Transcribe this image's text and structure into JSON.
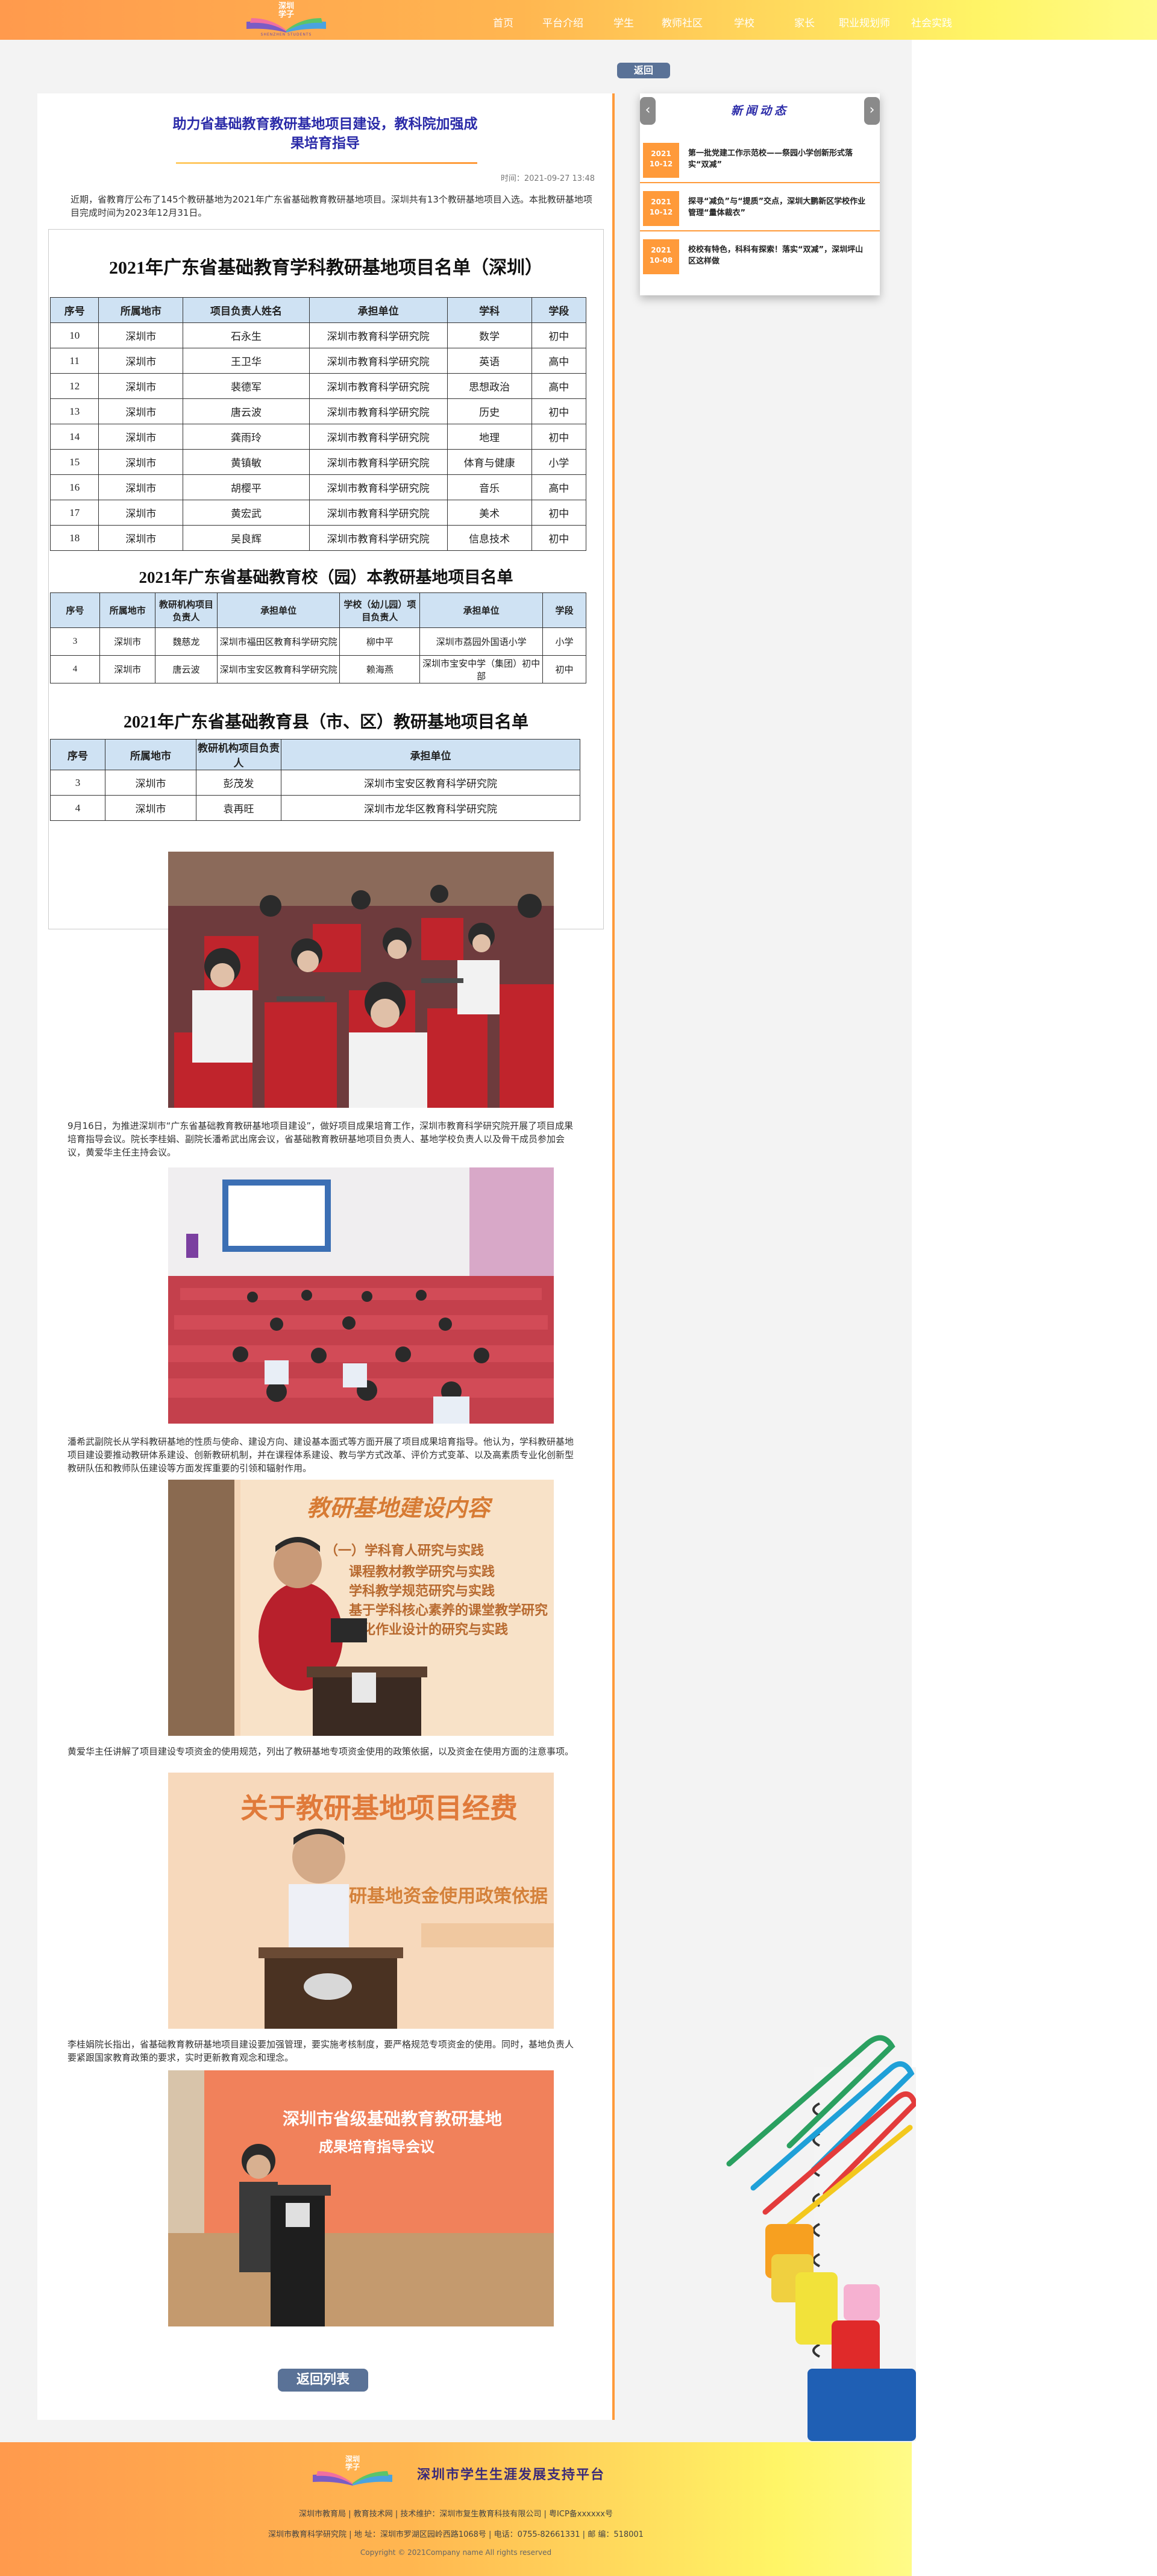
{
  "header": {
    "logo_text": "深圳\n学子",
    "logo_sub": "SHENZHEN STUDENTS",
    "nav": [
      "首页",
      "平台介绍",
      "学生",
      "教师社区",
      "学校",
      "家长",
      "职业规划师",
      "社会实践"
    ]
  },
  "back_button": "返回",
  "article": {
    "title_line1": "助力省基础教育教研基地项目建设，教科院加强成",
    "title_line2": "果培育指导",
    "datetime": "时间：2021-09-27 13:48",
    "intro": "近期，省教育厅公布了145个教研基地为2021年广东省基础教育教研基地项目。深圳共有13个教研基地项目入选。本批教研基地项目完成时间为2023年12月31日。",
    "table1": {
      "title": "2021年广东省基础教育学科教研基地项目名单（深圳）",
      "headers": [
        "序号",
        "所属地市",
        "项目负责人姓名",
        "承担单位",
        "学科",
        "学段"
      ],
      "rows": [
        [
          "10",
          "深圳市",
          "石永生",
          "深圳市教育科学研究院",
          "数学",
          "初中"
        ],
        [
          "11",
          "深圳市",
          "王卫华",
          "深圳市教育科学研究院",
          "英语",
          "高中"
        ],
        [
          "12",
          "深圳市",
          "裴德军",
          "深圳市教育科学研究院",
          "思想政治",
          "高中"
        ],
        [
          "13",
          "深圳市",
          "唐云波",
          "深圳市教育科学研究院",
          "历史",
          "初中"
        ],
        [
          "14",
          "深圳市",
          "龚雨玲",
          "深圳市教育科学研究院",
          "地理",
          "初中"
        ],
        [
          "15",
          "深圳市",
          "黄镇敏",
          "深圳市教育科学研究院",
          "体育与健康",
          "小学"
        ],
        [
          "16",
          "深圳市",
          "胡樱平",
          "深圳市教育科学研究院",
          "音乐",
          "高中"
        ],
        [
          "17",
          "深圳市",
          "黄宏武",
          "深圳市教育科学研究院",
          "美术",
          "初中"
        ],
        [
          "18",
          "深圳市",
          "吴良辉",
          "深圳市教育科学研究院",
          "信息技术",
          "初中"
        ]
      ]
    },
    "table2": {
      "title": "2021年广东省基础教育校（园）本教研基地项目名单",
      "headers": [
        "序号",
        "所属地市",
        "教研机构项目负责人",
        "承担单位",
        "学校（幼儿园）项目负责人",
        "承担单位",
        "学段"
      ],
      "rows": [
        [
          "3",
          "深圳市",
          "魏慈龙",
          "深圳市福田区教育科学研究院",
          "柳中平",
          "深圳市荔园外国语小学",
          "小学"
        ],
        [
          "4",
          "深圳市",
          "唐云波",
          "深圳市宝安区教育科学研究院",
          "赖海燕",
          "深圳市宝安中学（集团）初中部",
          "初中"
        ]
      ]
    },
    "table3": {
      "title": "2021年广东省基础教育县（市、区）教研基地项目名单",
      "headers": [
        "序号",
        "所属地市",
        "教研机构项目负责人",
        "承担单位"
      ],
      "rows": [
        [
          "3",
          "深圳市",
          "彭茂发",
          "深圳市宝安区教育科学研究院"
        ],
        [
          "4",
          "深圳市",
          "袁再旺",
          "深圳市龙华区教育科学研究院"
        ]
      ]
    },
    "para1": "9月16日，为推进深圳市“广东省基础教育教研基地项目建设”，做好项目成果培育工作，深圳市教育科学研究院开展了项目成果培育指导会议。院长李桂娟、副院长潘希武出席会议，省基础教育教研基地项目负责人、基地学校负责人以及骨干成员参加会议，黄爱华主任主持会议。",
    "para2": "潘希武副院长从学科教研基地的性质与使命、建设方向、建设基本面式等方面开展了项目成果培育指导。他认为，学科教研基地项目建设要推动教研体系建设、创新教研机制，并在课程体系建设、教与学方式改革、评价方式变革、以及高素质专业化创新型教研队伍和教师队伍建设等方面发挥重要的引领和辐射作用。",
    "para3": "黄爱华主任讲解了项目建设专项资金的使用规范，列出了教研基地专项资金使用的政策依据，以及资金在使用方面的注意事项。",
    "para4": "李桂娟院长指出，省基础教育教研基地项目建设要加强管理，要实施考核制度，要严格规范专项资金的使用。同时，基地负责人要紧跟国家教育政策的要求，实时更新教育观念和理念。",
    "photo3_text": {
      "title": "教研基地建设内容",
      "lines": [
        "（一）学科育人研究与实践",
        "课程教材教学研究与实践",
        "学科教学规范研究与实践",
        "基于学科核心素养的课堂教学研究",
        "大化作业设计的研究与实践"
      ]
    },
    "photo4_text": {
      "title": "关于教研基地项目经费",
      "sub": "教研基地资金使用政策依据"
    },
    "photo5_text": {
      "line1": "深圳市省级基础教育教研基地",
      "line2": "成果培育指导会议"
    },
    "back_list": "返回列表"
  },
  "news": {
    "title": "新闻动态",
    "prev": "‹",
    "next": "›",
    "items": [
      {
        "date1": "2021",
        "date2": "10-12",
        "text": "第一批党建工作示范校——祭园小学创新形式落实“双减”"
      },
      {
        "date1": "2021",
        "date2": "10-12",
        "text": "探寻“减负”与“提质”交点，深圳大鹏新区学校作业管理“量体裁衣”"
      },
      {
        "date1": "2021",
        "date2": "10-08",
        "text": "校校有特色，科科有探索！落实“双减”，深圳坪山区这样做"
      }
    ]
  },
  "footer": {
    "logo_text": "深圳\n学子",
    "title": "深圳市学生生涯发展支持平台",
    "links": [
      "深圳市教育局",
      "教育技术网",
      "技术维护：深圳市复生教育科技有限公司",
      "粤ICP备xxxxxx号"
    ],
    "line2": [
      "深圳市教育科学研究院",
      "地  址：深圳市罗湖区园岭西路1068号",
      "电话：0755-82661331",
      "邮  编：518001"
    ],
    "copyright": "Copyright © 2021Company name All rights reserved"
  },
  "colors": {
    "accent": "#ff9a3a",
    "navy": "#2a2aa8",
    "button": "#5a7297",
    "table_header": "#cfe2f3"
  }
}
